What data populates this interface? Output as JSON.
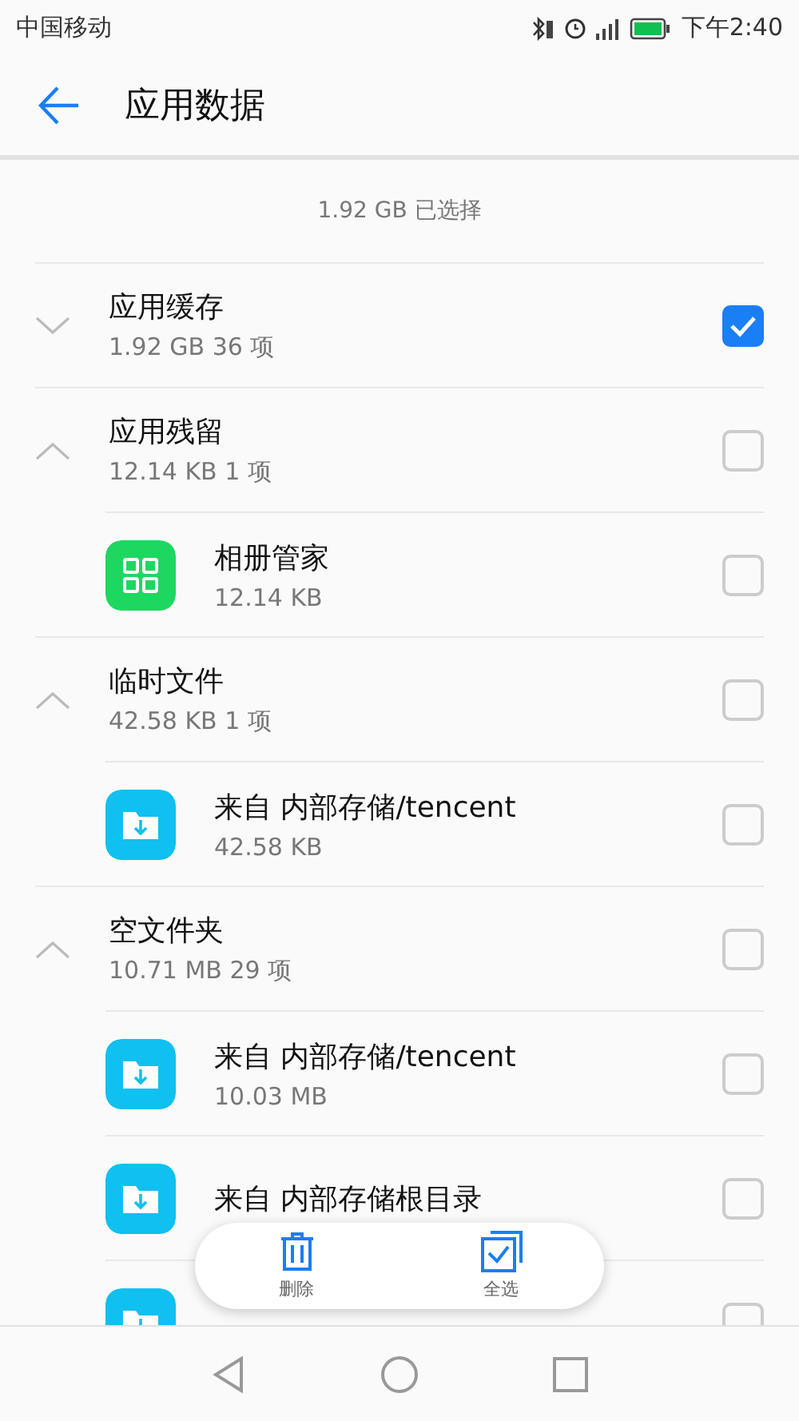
{
  "status_bar": {
    "carrier": "中国移动",
    "time": "下午2:40"
  },
  "header": {
    "title": "应用数据"
  },
  "summary": "1.92 GB 已选择",
  "groups": [
    {
      "title": "应用缓存",
      "subtitle": "1.92 GB  36 项",
      "expanded": false,
      "checked": true
    },
    {
      "title": "应用残留",
      "subtitle": "12.14 KB  1 项",
      "expanded": true,
      "checked": false,
      "children": [
        {
          "kind": "gallery",
          "title": "相册管家",
          "subtitle": "12.14 KB",
          "checked": false
        }
      ]
    },
    {
      "title": "临时文件",
      "subtitle": "42.58 KB  1 项",
      "expanded": true,
      "checked": false,
      "children": [
        {
          "kind": "folder",
          "title": "来自 内部存储/tencent",
          "subtitle": "42.58 KB",
          "checked": false
        }
      ]
    },
    {
      "title": "空文件夹",
      "subtitle": "10.71 MB  29 项",
      "expanded": true,
      "checked": false,
      "children": [
        {
          "kind": "folder",
          "title": "来自 内部存储/tencent",
          "subtitle": "10.03 MB",
          "checked": false
        },
        {
          "kind": "folder",
          "title": "来自 内部存储根目录",
          "checked": false
        },
        {
          "kind": "folder",
          "checked": false
        }
      ]
    }
  ],
  "action_bar": [
    {
      "kind": "delete",
      "label": "删除"
    },
    {
      "kind": "select_all",
      "label": "全选"
    }
  ]
}
